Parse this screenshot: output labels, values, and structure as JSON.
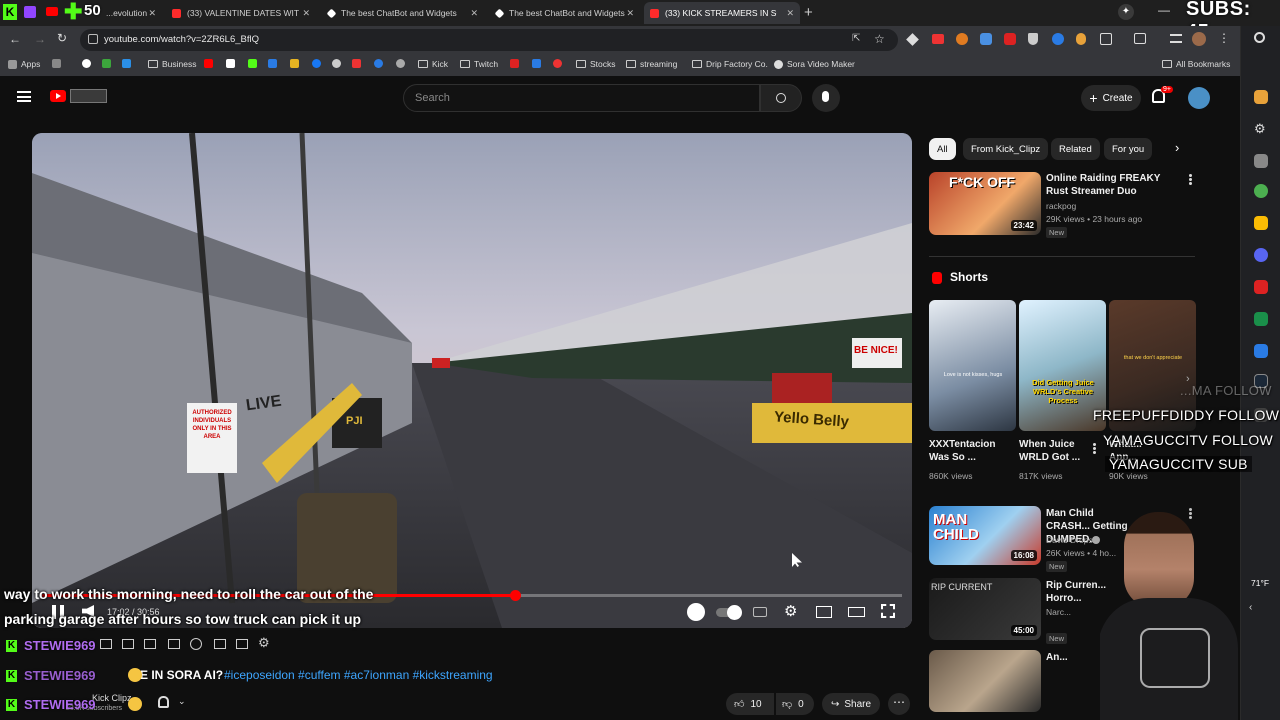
{
  "browser": {
    "tabs": [
      {
        "title": "...evolution - Yo",
        "active": false
      },
      {
        "title": "(33) VALENTINE DATES WITH S",
        "active": false
      },
      {
        "title": "The best ChatBot and Widgets",
        "active": false
      },
      {
        "title": "The best ChatBot and Widgets",
        "active": false
      },
      {
        "title": "(33) KICK STREAMERS IN SORA",
        "active": true
      }
    ],
    "tab_badge": "50",
    "url": "youtube.com/watch?v=2ZR6L6_BflQ",
    "bookmarks": [
      "Apps",
      "Business",
      "Kick",
      "Twitch",
      "Stocks",
      "streaming",
      "Drip Factory Co.",
      "Sora Video Maker"
    ],
    "all_bookmarks": "All Bookmarks",
    "subs_overlay": "SUBS: 45"
  },
  "youtube": {
    "search_placeholder": "Search",
    "create_label": "Create",
    "notif_count": "9+"
  },
  "video": {
    "sign_authorized": "AUTHORIZED INDIVIDUALS ONLY IN THIS AREA",
    "sign_live": "LIVE",
    "sign_be_nice": "BE NICE!",
    "sign_yello": "Yello Belly",
    "barrel_label": "PJI",
    "time": "17:02 / 30:56",
    "progress": 0.55,
    "chapter_title": "..."
  },
  "captions": {
    "line1": "way to work this morning, need to roll the car out of the",
    "line2": "parking garage after hours so tow truck can pick it up"
  },
  "below_video": {
    "title_fragment": "ME IN SORA AI?",
    "hashtags": "#iceposeidon #cuffem #ac7ionman #kickstreaming",
    "channel": "Kick Clipz",
    "subs": "23.5K subscribers",
    "likes": "10",
    "dislikes": "0",
    "share_label": "Share"
  },
  "chat_overlay": {
    "names": [
      "STEWIE969",
      "STEWIE969",
      "STEWIE969"
    ]
  },
  "stream_overlay": {
    "lines": [
      "FREEPUFFDIDDY  FOLLOW",
      "YAMAGUCCITV  FOLLOW",
      "YAMAGUCCITV  SUB"
    ],
    "faint_line": "...MA FOLLOW"
  },
  "sidebar": {
    "chips": [
      "All",
      "From Kick_Clipz",
      "Related",
      "For you"
    ],
    "top_video": {
      "thumb_text": "F*CK OFF",
      "title": "Online Raiding FREAKY Rust Streamer Duo",
      "channel": "rackpog",
      "meta": "29K views • 23 hours ago",
      "badge": "New",
      "duration": "23:42"
    },
    "shorts_title": "Shorts",
    "shorts": [
      {
        "title": "XXXTentacion Was So ...",
        "views": "860K views",
        "thumb_text": "Love is not kisses, hugs"
      },
      {
        "title": "When Juice WRLD Got ...",
        "views": "817K views",
        "thumb_text": "Did Getting Juice WRLD's Creative Process"
      },
      {
        "title": "What... App...",
        "views": "90K views",
        "thumb_text": "that we don't appreciate"
      }
    ],
    "videos": [
      {
        "title": "Man Child CRASH... Getting DUMPED...",
        "channel": "David Drops",
        "meta": "26K views • 4 ho...",
        "badge": "New",
        "duration": "16:08",
        "thumb_text": "MAN CHILD"
      },
      {
        "title": "Rip Curren... Horro...",
        "channel": "Narc...",
        "meta": "...",
        "badge": "New",
        "duration": "45:00",
        "thumb_text": "RIP CURRENT"
      },
      {
        "title": "An...",
        "channel": "",
        "meta": "",
        "badge": "",
        "duration": "",
        "thumb_text": ""
      }
    ]
  },
  "system": {
    "temp": "71°F"
  }
}
